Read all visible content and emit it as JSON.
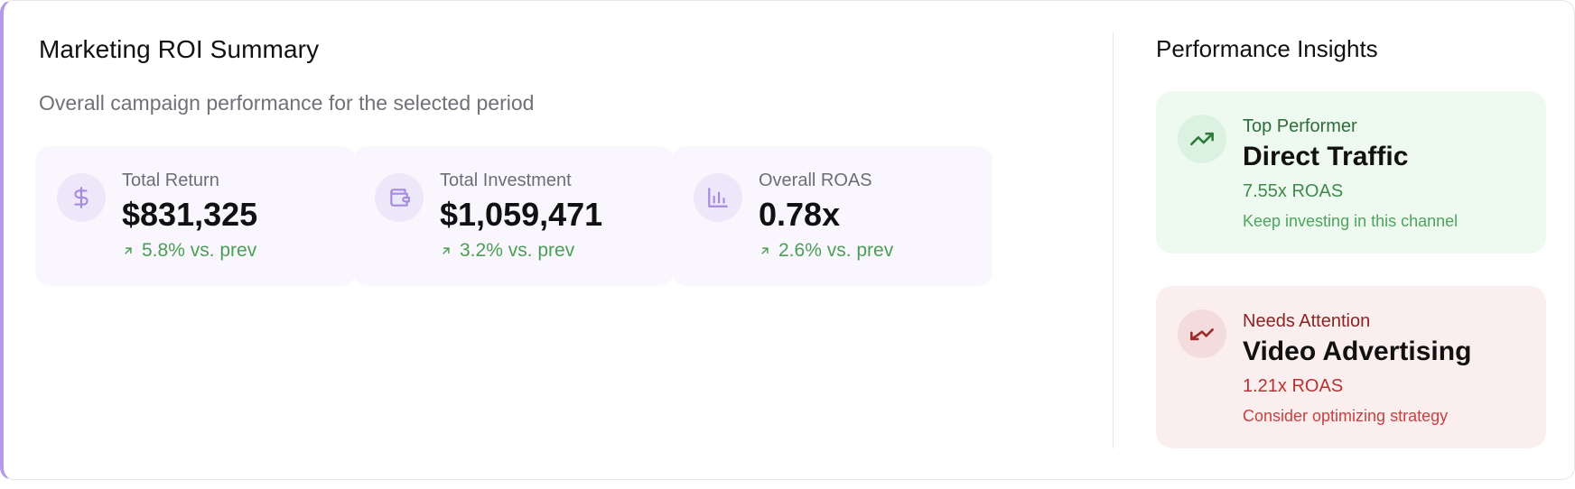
{
  "summary": {
    "title": "Marketing ROI Summary",
    "subtitle": "Overall campaign performance for the selected period",
    "metrics": [
      {
        "icon": "dollar-icon",
        "label": "Total Return",
        "value": "$831,325",
        "change": "5.8% vs. prev"
      },
      {
        "icon": "wallet-icon",
        "label": "Total Investment",
        "value": "$1,059,471",
        "change": "3.2% vs. prev"
      },
      {
        "icon": "bar-chart-icon",
        "label": "Overall ROAS",
        "value": "0.78x",
        "change": "2.6% vs. prev"
      }
    ]
  },
  "insights": {
    "title": "Performance Insights",
    "top": {
      "icon": "trending-up-icon",
      "kicker": "Top Performer",
      "name": "Direct Traffic",
      "roas": "7.55x ROAS",
      "advice": "Keep investing in this channel"
    },
    "attention": {
      "icon": "trending-down-icon",
      "kicker": "Needs Attention",
      "name": "Video Advertising",
      "roas": "1.21x ROAS",
      "advice": "Consider optimizing strategy"
    }
  },
  "colors": {
    "accent": "#b39ae8",
    "positive": "#4a9e55",
    "negative": "#b83232"
  }
}
